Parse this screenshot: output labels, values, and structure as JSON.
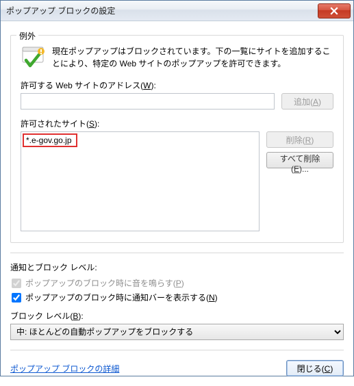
{
  "title": "ポップアップ ブロックの設定",
  "exceptions": {
    "group": "例外",
    "info": "現在ポップアップはブロックされています。下の一覧にサイトを追加することにより、特定の Web サイトのポップアップを許可できます。",
    "address_label_pre": "許可する Web サイトのアドレス(",
    "address_accel": "W",
    "address_label_post": "):",
    "address_value": "",
    "add_pre": "追加(",
    "add_accel": "A",
    "add_post": ")",
    "allowed_label_pre": "許可されたサイト(",
    "allowed_accel": "S",
    "allowed_label_post": "):",
    "allowed_sites": [
      "*.e-gov.go.jp"
    ],
    "remove_pre": "削除(",
    "remove_accel": "R",
    "remove_post": ")",
    "removeall_pre": "すべて削除(",
    "removeall_accel": "E",
    "removeall_post": ")..."
  },
  "notify": {
    "section": "通知とブロック レベル:",
    "sound_pre": "ポップアップのブロック時に音を鳴らす(",
    "sound_accel": "P",
    "sound_post": ")",
    "bar_pre": "ポップアップのブロック時に通知バーを表示する(",
    "bar_accel": "N",
    "bar_post": ")",
    "level_label_pre": "ブロック レベル(",
    "level_accel": "B",
    "level_label_post": "):",
    "level_value": "中: ほとんどの自動ポップアップをブロックする"
  },
  "link": "ポップアップ ブロックの詳細",
  "close_pre": "閉じる(",
  "close_accel": "C",
  "close_post": ")"
}
